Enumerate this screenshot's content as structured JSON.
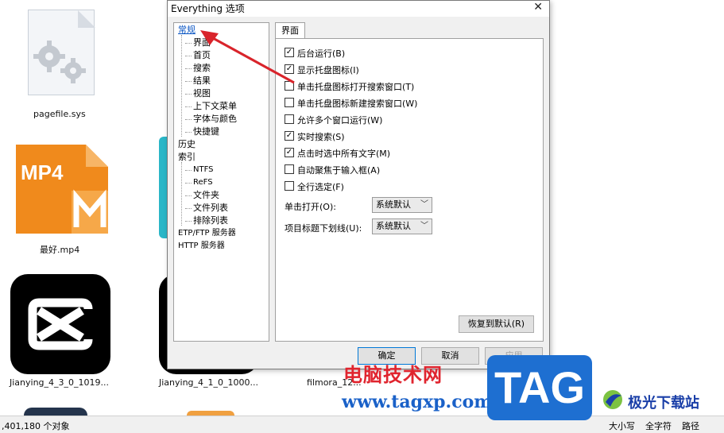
{
  "desktop": {
    "icons": [
      {
        "label": "pagefile.sys"
      },
      {
        "label": "最好.mp4",
        "badge": "MP4"
      },
      {
        "label": "Jianying_4_3_0_1019..."
      },
      {
        "label": "Jianying_4_1_0_1000..."
      },
      {
        "label": "filmora_12..."
      }
    ]
  },
  "dialog": {
    "title": "Everything 选项",
    "close_glyph": "✕",
    "tree": {
      "items": [
        {
          "label": "常规",
          "level": 0,
          "selected": true
        },
        {
          "label": "界面",
          "level": 1
        },
        {
          "label": "首页",
          "level": 1
        },
        {
          "label": "搜索",
          "level": 1
        },
        {
          "label": "结果",
          "level": 1
        },
        {
          "label": "视图",
          "level": 1
        },
        {
          "label": "上下文菜单",
          "level": 1
        },
        {
          "label": "字体与颜色",
          "level": 1
        },
        {
          "label": "快捷键",
          "level": 1
        },
        {
          "label": "历史",
          "level": 0
        },
        {
          "label": "索引",
          "level": 0
        },
        {
          "label": "NTFS",
          "level": 1
        },
        {
          "label": "ReFS",
          "level": 1
        },
        {
          "label": "文件夹",
          "level": 1
        },
        {
          "label": "文件列表",
          "level": 1
        },
        {
          "label": "排除列表",
          "level": 1
        },
        {
          "label": "ETP/FTP 服务器",
          "level": 0
        },
        {
          "label": "HTTP 服务器",
          "level": 0
        }
      ]
    },
    "tab": {
      "label": "界面"
    },
    "checkboxes": [
      {
        "label": "后台运行(B)",
        "checked": true
      },
      {
        "label": "显示托盘图标(I)",
        "checked": true
      },
      {
        "label": "单击托盘图标打开搜索窗口(T)",
        "checked": false
      },
      {
        "label": "单击托盘图标新建搜索窗口(W)",
        "checked": false
      },
      {
        "label": "允许多个窗口运行(W)",
        "checked": false
      },
      {
        "label": "实时搜索(S)",
        "checked": true
      },
      {
        "label": "点击时选中所有文字(M)",
        "checked": true
      },
      {
        "label": "自动聚焦于输入框(A)",
        "checked": false
      },
      {
        "label": "全行选定(F)",
        "checked": false
      }
    ],
    "selects": [
      {
        "label": "单击打开(O):",
        "value": "系统默认"
      },
      {
        "label": "项目标题下划线(U):",
        "value": "系统默认"
      }
    ],
    "check_glyph": "✓",
    "arrow_glyph": "﹀",
    "restore_label": "恢复到默认(R)",
    "ok_label": "确定",
    "cancel_label": "取消",
    "apply_label": "应用"
  },
  "statusbar": {
    "count": ",401,180 个对象",
    "case": "大小写",
    "whole_word": "全字符",
    "path": "路径"
  },
  "watermark": {
    "cn_text": "电脑技术网",
    "url": "www.tagxp.com",
    "tag": "TAG",
    "brand": "极光下载站"
  },
  "colors": {
    "accent": "#0078d7",
    "annotation_arrow": "#d9242b",
    "watermark_red": "#e0242e",
    "watermark_blue": "#1e6fd1"
  }
}
